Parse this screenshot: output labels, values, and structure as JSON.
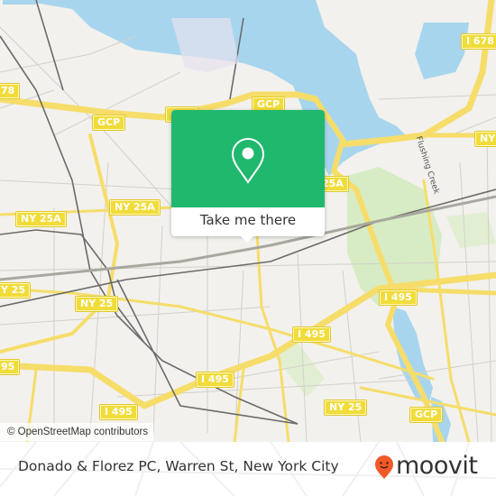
{
  "map": {
    "attribution": "© OpenStreetMap contributors",
    "road_labels": [
      {
        "id": "i678",
        "text": "I 678"
      },
      {
        "id": "ny-left-top",
        "text": "78"
      },
      {
        "id": "gcp-1",
        "text": "GCP"
      },
      {
        "id": "gcp-2",
        "text": "GCP"
      },
      {
        "id": "gcp-3",
        "text": "GCP"
      },
      {
        "id": "ny-right",
        "text": "NY"
      },
      {
        "id": "ny25a-1",
        "text": "NY 25A"
      },
      {
        "id": "ny25a-2",
        "text": "NY 25A"
      },
      {
        "id": "ny25a-3",
        "text": "25A"
      },
      {
        "id": "ny25-1",
        "text": "Y 25"
      },
      {
        "id": "ny25-2",
        "text": "NY 25"
      },
      {
        "id": "ny25-3",
        "text": "NY 25"
      },
      {
        "id": "i495-1",
        "text": "I 495"
      },
      {
        "id": "i495-2",
        "text": "I 495"
      },
      {
        "id": "i495-3",
        "text": "I 495"
      },
      {
        "id": "i495-4",
        "text": "I 495"
      },
      {
        "id": "i495-5",
        "text": "95"
      },
      {
        "id": "gcp-4",
        "text": "GCP"
      }
    ],
    "street_labels": [
      {
        "text": "Flushing Creek"
      }
    ],
    "colors": {
      "land": "#f2f1ed",
      "water": "#a8d5ee",
      "park": "#d7ecc4",
      "highway": "#f6dd6a",
      "rail": "#6b6b6b"
    }
  },
  "popup": {
    "icon": "location-pin-icon",
    "cta_label": "Take me there",
    "color": "#1fb86c"
  },
  "footer": {
    "place_name": "Donado & Florez PC, Warren St, New York City",
    "brand": "moovit",
    "brand_color": "#f05a28"
  }
}
